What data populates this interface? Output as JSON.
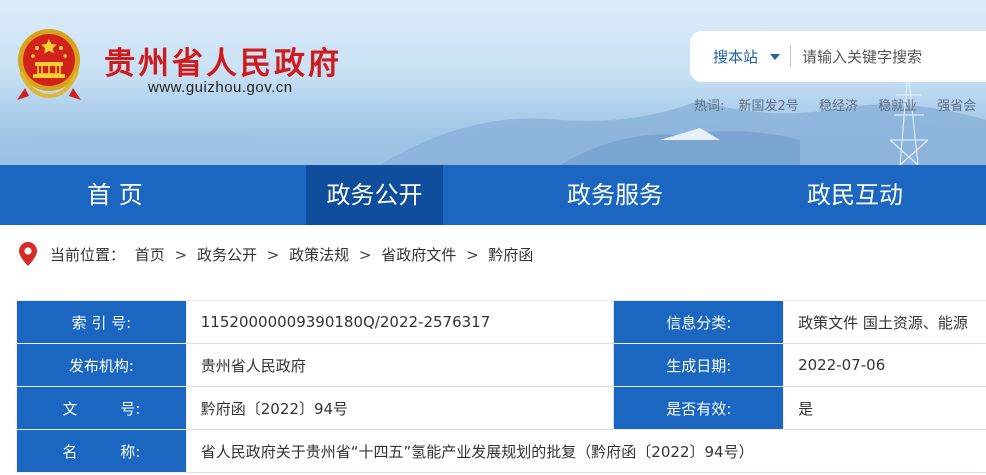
{
  "header": {
    "title": "贵州省人民政府",
    "url": "www.guizhou.gov.cn",
    "search": {
      "scope": "搜本站",
      "placeholder": "请输入关键字搜索"
    },
    "hot": {
      "label": "热词:",
      "items": [
        "新国发2号",
        "稳经济",
        "稳就业",
        "强省会"
      ]
    }
  },
  "nav": {
    "items": [
      {
        "label": "首 页",
        "active": false
      },
      {
        "label": "政务公开",
        "active": true
      },
      {
        "label": "政务服务",
        "active": false
      },
      {
        "label": "政民互动",
        "active": false
      }
    ]
  },
  "breadcrumb": {
    "label": "当前位置：",
    "items": [
      "首页",
      "政务公开",
      "政策法规",
      "省政府文件",
      "黔府函"
    ],
    "separator": ">"
  },
  "info": {
    "index_label": "索 引 号:",
    "index_value": "11520000009390180Q/2022-2576317",
    "category_label": "信息分类:",
    "category_value": "政策文件    国土资源、能源",
    "org_label": "发布机构:",
    "org_value": "贵州省人民政府",
    "date_label": "生成日期:",
    "date_value": "2022-07-06",
    "docno_label": "文         号:",
    "docno_value": "黔府函〔2022〕94号",
    "valid_label": "是否有效:",
    "valid_value": "是",
    "name_label": "名         称:",
    "name_value": "省人民政府关于贵州省“十四五”氢能产业发展规划的批复（黔府函〔2022〕94号）"
  },
  "colors": {
    "brand_red": "#cf1b1b",
    "nav_blue": "#1a66c0",
    "nav_active": "#0f4e9c"
  }
}
